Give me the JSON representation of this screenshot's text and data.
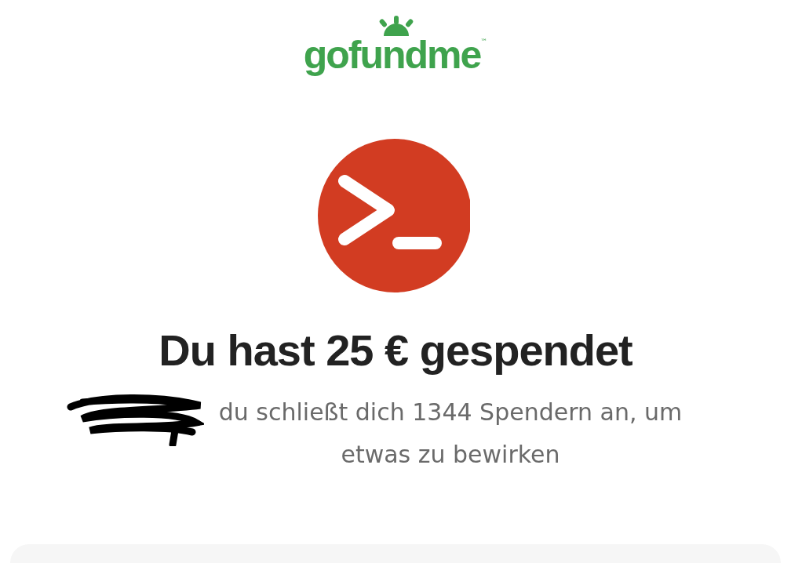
{
  "logo": {
    "wordmark": "gofundme",
    "trademark": "™"
  },
  "heading": "Du hast 25 € gespendet",
  "message": "du schließt dich 1344 Spendern an, um etwas zu bewirken"
}
